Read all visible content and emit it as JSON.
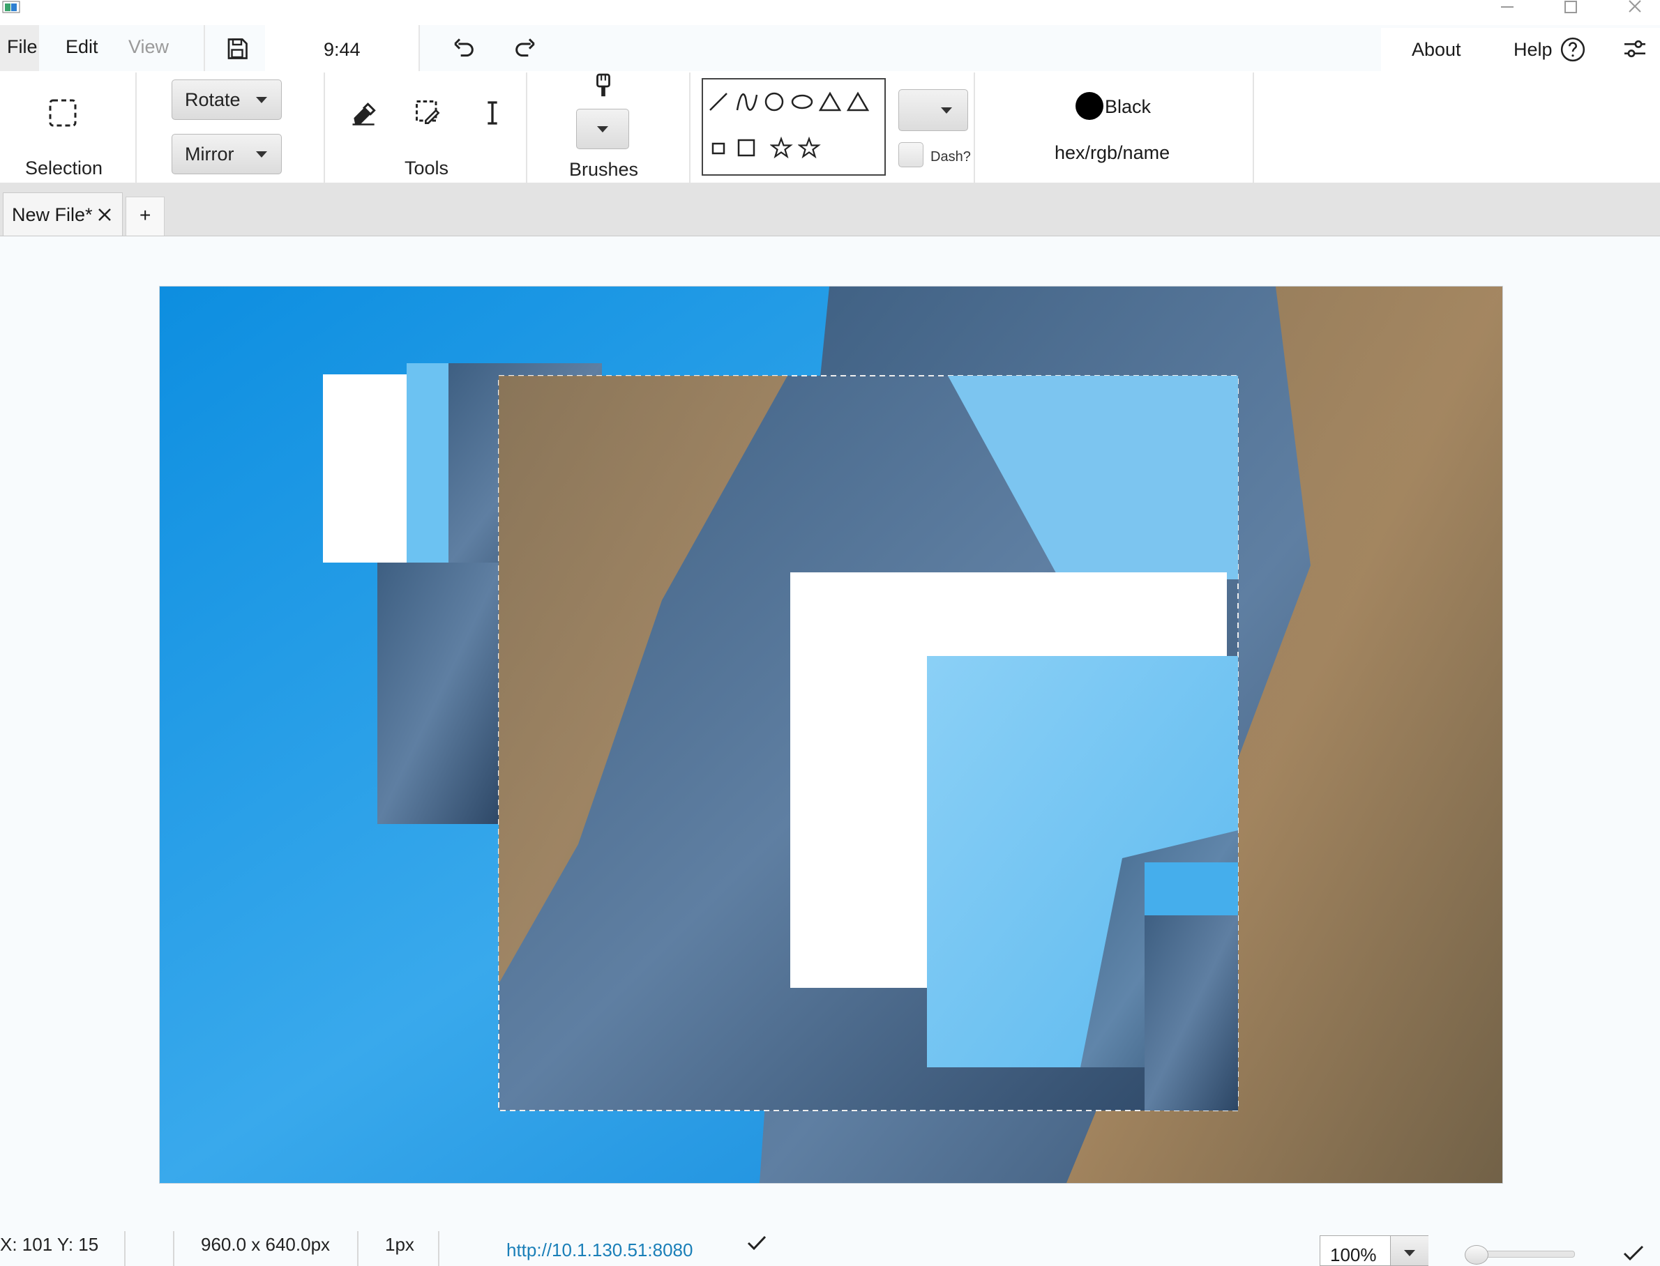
{
  "menu": {
    "file": "File",
    "edit": "Edit",
    "view": "View",
    "time": "9:44",
    "about": "About",
    "help": "Help"
  },
  "ribbon": {
    "selection_label": "Selection",
    "rotate_label": "Rotate",
    "mirror_label": "Mirror",
    "tools_label": "Tools",
    "brushes_label": "Brushes",
    "dash_label": "Dash?",
    "color_name": "Black",
    "color_placeholder": "hex/rgb/name"
  },
  "tabs": {
    "active_label": "New File*",
    "add_label": "+"
  },
  "status": {
    "coords": "X: 101 Y: 15",
    "canvas_size": "960.0 x 640.0px",
    "stroke": "1px",
    "url": "http://10.1.130.51:8080",
    "zoom": "100%"
  },
  "colors": {
    "accent": "#1a73c9",
    "link": "#1a7fb8",
    "selected_color": "#000000"
  },
  "icons": [
    "app-icon",
    "minimize-icon",
    "maximize-icon",
    "close-icon",
    "save-icon",
    "undo-icon",
    "redo-icon",
    "help-circle-icon",
    "settings-sliders-icon",
    "selection-rect-icon",
    "eraser-icon",
    "select-edit-icon",
    "text-cursor-icon",
    "brush-icon",
    "line-icon",
    "curve-icon",
    "circle-icon",
    "ellipse-icon",
    "triangle-icon",
    "square-icon",
    "star-icon",
    "check-icon"
  ]
}
